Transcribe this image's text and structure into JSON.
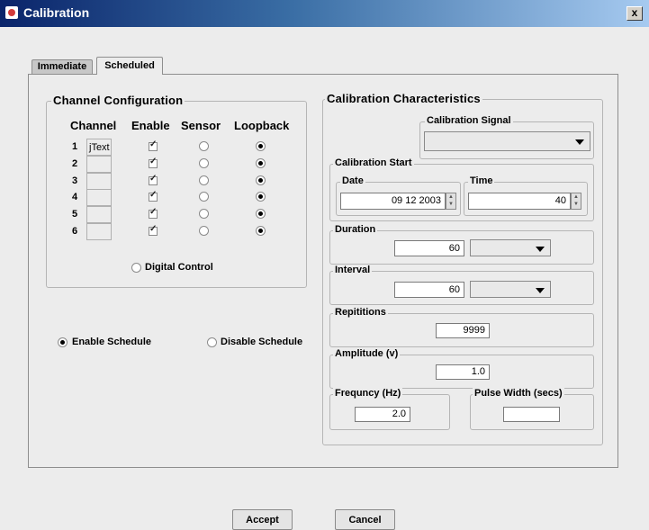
{
  "window": {
    "title": "Calibration",
    "close_label": "x"
  },
  "tabs": [
    {
      "label": "Immediate",
      "active": false
    },
    {
      "label": "Scheduled",
      "active": true
    }
  ],
  "channel_config": {
    "title": "Channel Configuration",
    "headers": {
      "channel": "Channel",
      "enable": "Enable",
      "sensor": "Sensor",
      "loopback": "Loopback"
    },
    "rows": [
      {
        "num": "1",
        "text": "jText",
        "enabled": true,
        "mode": "loopback"
      },
      {
        "num": "2",
        "text": "",
        "enabled": true,
        "mode": "loopback"
      },
      {
        "num": "3",
        "text": "",
        "enabled": true,
        "mode": "loopback"
      },
      {
        "num": "4",
        "text": "",
        "enabled": true,
        "mode": "loopback"
      },
      {
        "num": "5",
        "text": "",
        "enabled": true,
        "mode": "loopback"
      },
      {
        "num": "6",
        "text": "",
        "enabled": true,
        "mode": "loopback"
      }
    ],
    "digital_control_label": "Digital Control"
  },
  "schedule": {
    "enable_label": "Enable Schedule",
    "disable_label": "Disable Schedule",
    "selected": "enable"
  },
  "calibration": {
    "title": "Calibration Characteristics",
    "signal_label": "Calibration Signal",
    "signal_value": "",
    "start_label": "Calibration Start",
    "date_label": "Date",
    "date_value": "09 12 2003",
    "time_label": "Time",
    "time_value": "40",
    "duration_label": "Duration",
    "duration_value": "60",
    "duration_unit": "",
    "interval_label": "Interval",
    "interval_value": "60",
    "interval_unit": "",
    "repetitions_label": "Repititions",
    "repetitions_value": "9999",
    "amplitude_label": "Amplitude (v)",
    "amplitude_value": "1.0",
    "frequency_label": "Frequncy (Hz)",
    "frequency_value": "2.0",
    "pulse_width_label": "Pulse Width (secs)",
    "pulse_width_value": ""
  },
  "buttons": {
    "accept": "Accept",
    "cancel": "Cancel"
  }
}
